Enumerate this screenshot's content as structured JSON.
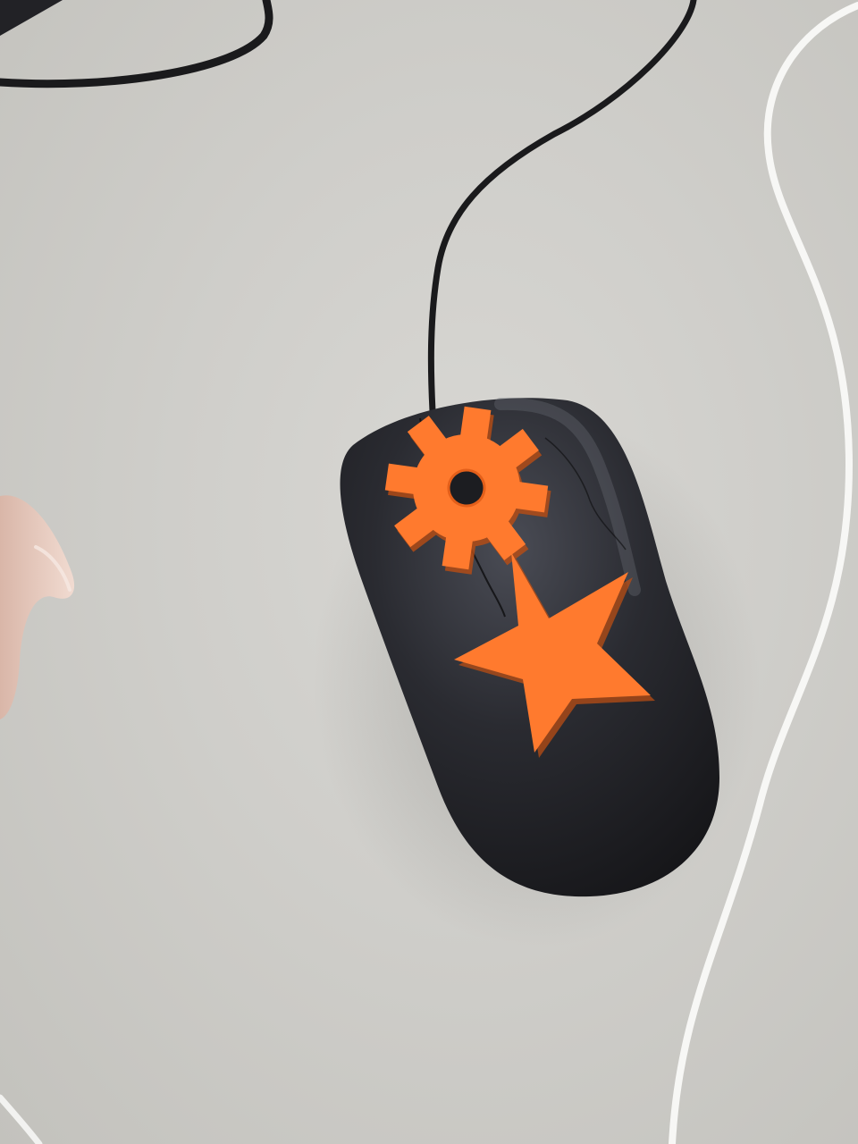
{
  "colors": {
    "desk": "#d2d1cc",
    "mouse_body": "#1f2024",
    "mouse_highlight": "#4a4c55",
    "orange_part": "#ff7a2e",
    "orange_shadow": "#e35f1a",
    "white_cable": "#f7f7f5",
    "black_cable": "#1a1a1c",
    "skin": "#e9cfc3"
  },
  "objects": {
    "mouse": "black-mouse",
    "gear": "orange-gear",
    "star": "orange-star",
    "cables": [
      "black-mouse-cable",
      "white-cable",
      "laptop-cable"
    ],
    "hand": "fingertip"
  }
}
